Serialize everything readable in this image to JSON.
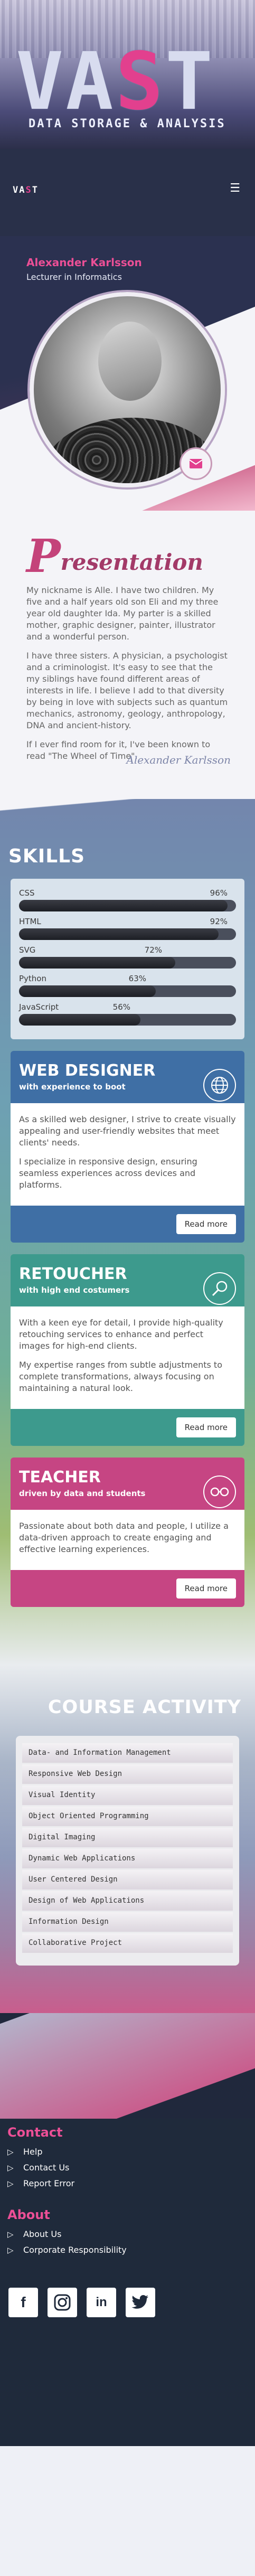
{
  "hero": {
    "logo_prefix": "VA",
    "logo_accent": "S",
    "logo_suffix": "T",
    "tagline": "DATA STORAGE & ANALYSIS"
  },
  "navbar": {
    "brand_prefix": "VA",
    "brand_accent": "S",
    "brand_suffix": "T",
    "menu_icon": "☰"
  },
  "profile": {
    "name": "Alexander Karlsson",
    "role": "Lecturer in Informatics"
  },
  "presentation": {
    "title_initial": "P",
    "title_rest": "resentation",
    "paragraphs": [
      "My nickname is Alle. I have two children. My five and a half years old son Eli and my three year old daughter Ida. My parter is a skilled mother, graphic designer, painter, illustrator and a wonderful person.",
      "I have three sisters. A physician, a psychologist and a criminologist. It's easy to see that the my siblings have found different areas of interests in life. I believe I add to that diversity by being in love with subjects such as quantum mechanics, astronomy, geology, anthropology, DNA and ancient-history.",
      "If I ever find room for it, I've been known to read \"The Wheel of Time\"."
    ],
    "signature": "Alexander Karlsson"
  },
  "skills": {
    "title": "SKILLS",
    "items": [
      {
        "label": "CSS",
        "value": "96%",
        "level": 96
      },
      {
        "label": "HTML",
        "value": "92%",
        "level": 92
      },
      {
        "label": "SVG",
        "value": "72%",
        "level": 72
      },
      {
        "label": "Python",
        "value": "63%",
        "level": 63
      },
      {
        "label": "JavaScript",
        "value": "56%",
        "level": 56
      }
    ]
  },
  "cards": {
    "web": {
      "title": "WEB DESIGNER",
      "subtitle": "with experience to boot",
      "paragraphs": [
        "As a skilled web designer, I strive to create visually appealing and user-friendly websites that meet clients' needs.",
        "I specialize in responsive design, ensuring seamless experiences across devices and platforms."
      ],
      "button": "Read more"
    },
    "ret": {
      "title": "RETOUCHER",
      "subtitle": "with high end costumers",
      "paragraphs": [
        "With a keen eye for detail, I provide high-quality retouching services to enhance and perfect images for high-end clients.",
        "My expertise ranges from subtle adjustments to complete transformations, always focusing on maintaining a natural look."
      ],
      "button": "Read more"
    },
    "tea": {
      "title": "TEACHER",
      "subtitle": "driven by data and students",
      "paragraphs": [
        "Passionate about both data and people, I utilize a data-driven approach to create engaging and effective learning experiences."
      ],
      "button": "Read more"
    }
  },
  "courses": {
    "title": "COURSE ACTIVITY",
    "items": [
      "Data- and Information Management",
      "Responsive Web Design",
      "Visual Identity",
      "Object Oriented Programming",
      "Digital Imaging",
      "Dynamic Web Applications",
      "User Centered Design",
      "Design of Web Applications",
      "Information Design",
      "Collaborative Project"
    ]
  },
  "footer": {
    "contact_title": "Contact",
    "contact_links": [
      "Help",
      "Contact Us",
      "Report Error"
    ],
    "about_title": "About",
    "about_links": [
      "About Us",
      "Corporate Responsibility"
    ],
    "social": {
      "facebook": "f",
      "linkedin": "in"
    }
  },
  "colors": {
    "accent": "#e2408e",
    "navy": "#293049",
    "web": "#3f6fa5",
    "retoucher": "#3d9a8d",
    "teacher": "#c64583"
  }
}
